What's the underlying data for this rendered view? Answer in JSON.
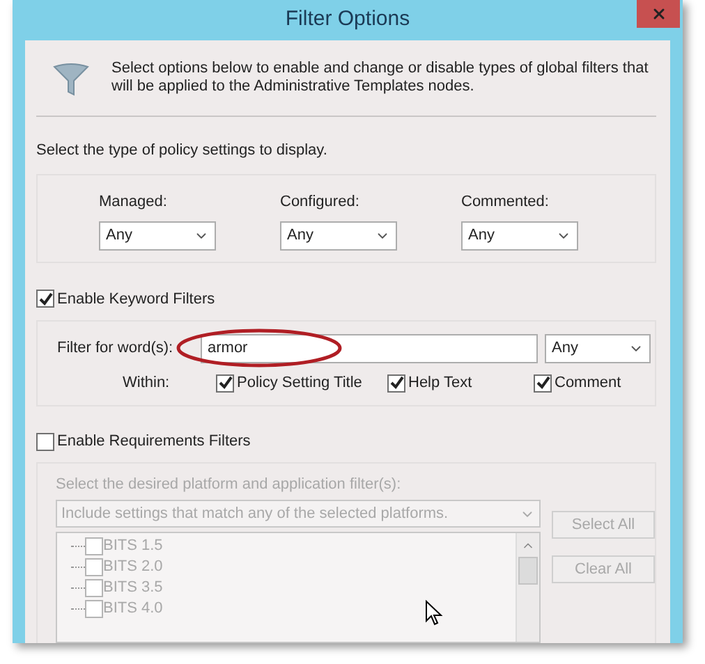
{
  "window": {
    "title": "Filter Options"
  },
  "intro": "Select options below to enable and change or disable types of global filters that will be applied to the Administrative Templates nodes.",
  "policy_type": {
    "label": "Select the type of policy settings to display.",
    "dropdowns": [
      {
        "label": "Managed:",
        "value": "Any"
      },
      {
        "label": "Configured:",
        "value": "Any"
      },
      {
        "label": "Commented:",
        "value": "Any"
      }
    ]
  },
  "keyword_filters": {
    "label": "Enable Keyword Filters",
    "checked": true,
    "field_label": "Filter for word(s):",
    "value": "armor",
    "match": "Any",
    "within_label": "Within:",
    "within": [
      {
        "label": "Policy Setting Title",
        "checked": true
      },
      {
        "label": "Help Text",
        "checked": true
      },
      {
        "label": "Comment",
        "checked": true
      }
    ]
  },
  "requirements_filters": {
    "label": "Enable Requirements Filters",
    "checked": false,
    "prompt": "Select the desired platform and application filter(s):",
    "mode": "Include settings that match any of the selected platforms.",
    "buttons": [
      "Select All",
      "Clear All"
    ],
    "platforms": [
      {
        "label": "BITS 1.5",
        "checked": false
      },
      {
        "label": "BITS 2.0",
        "checked": false
      },
      {
        "label": "BITS 3.5",
        "checked": false
      },
      {
        "label": "BITS 4.0",
        "checked": false
      }
    ]
  }
}
